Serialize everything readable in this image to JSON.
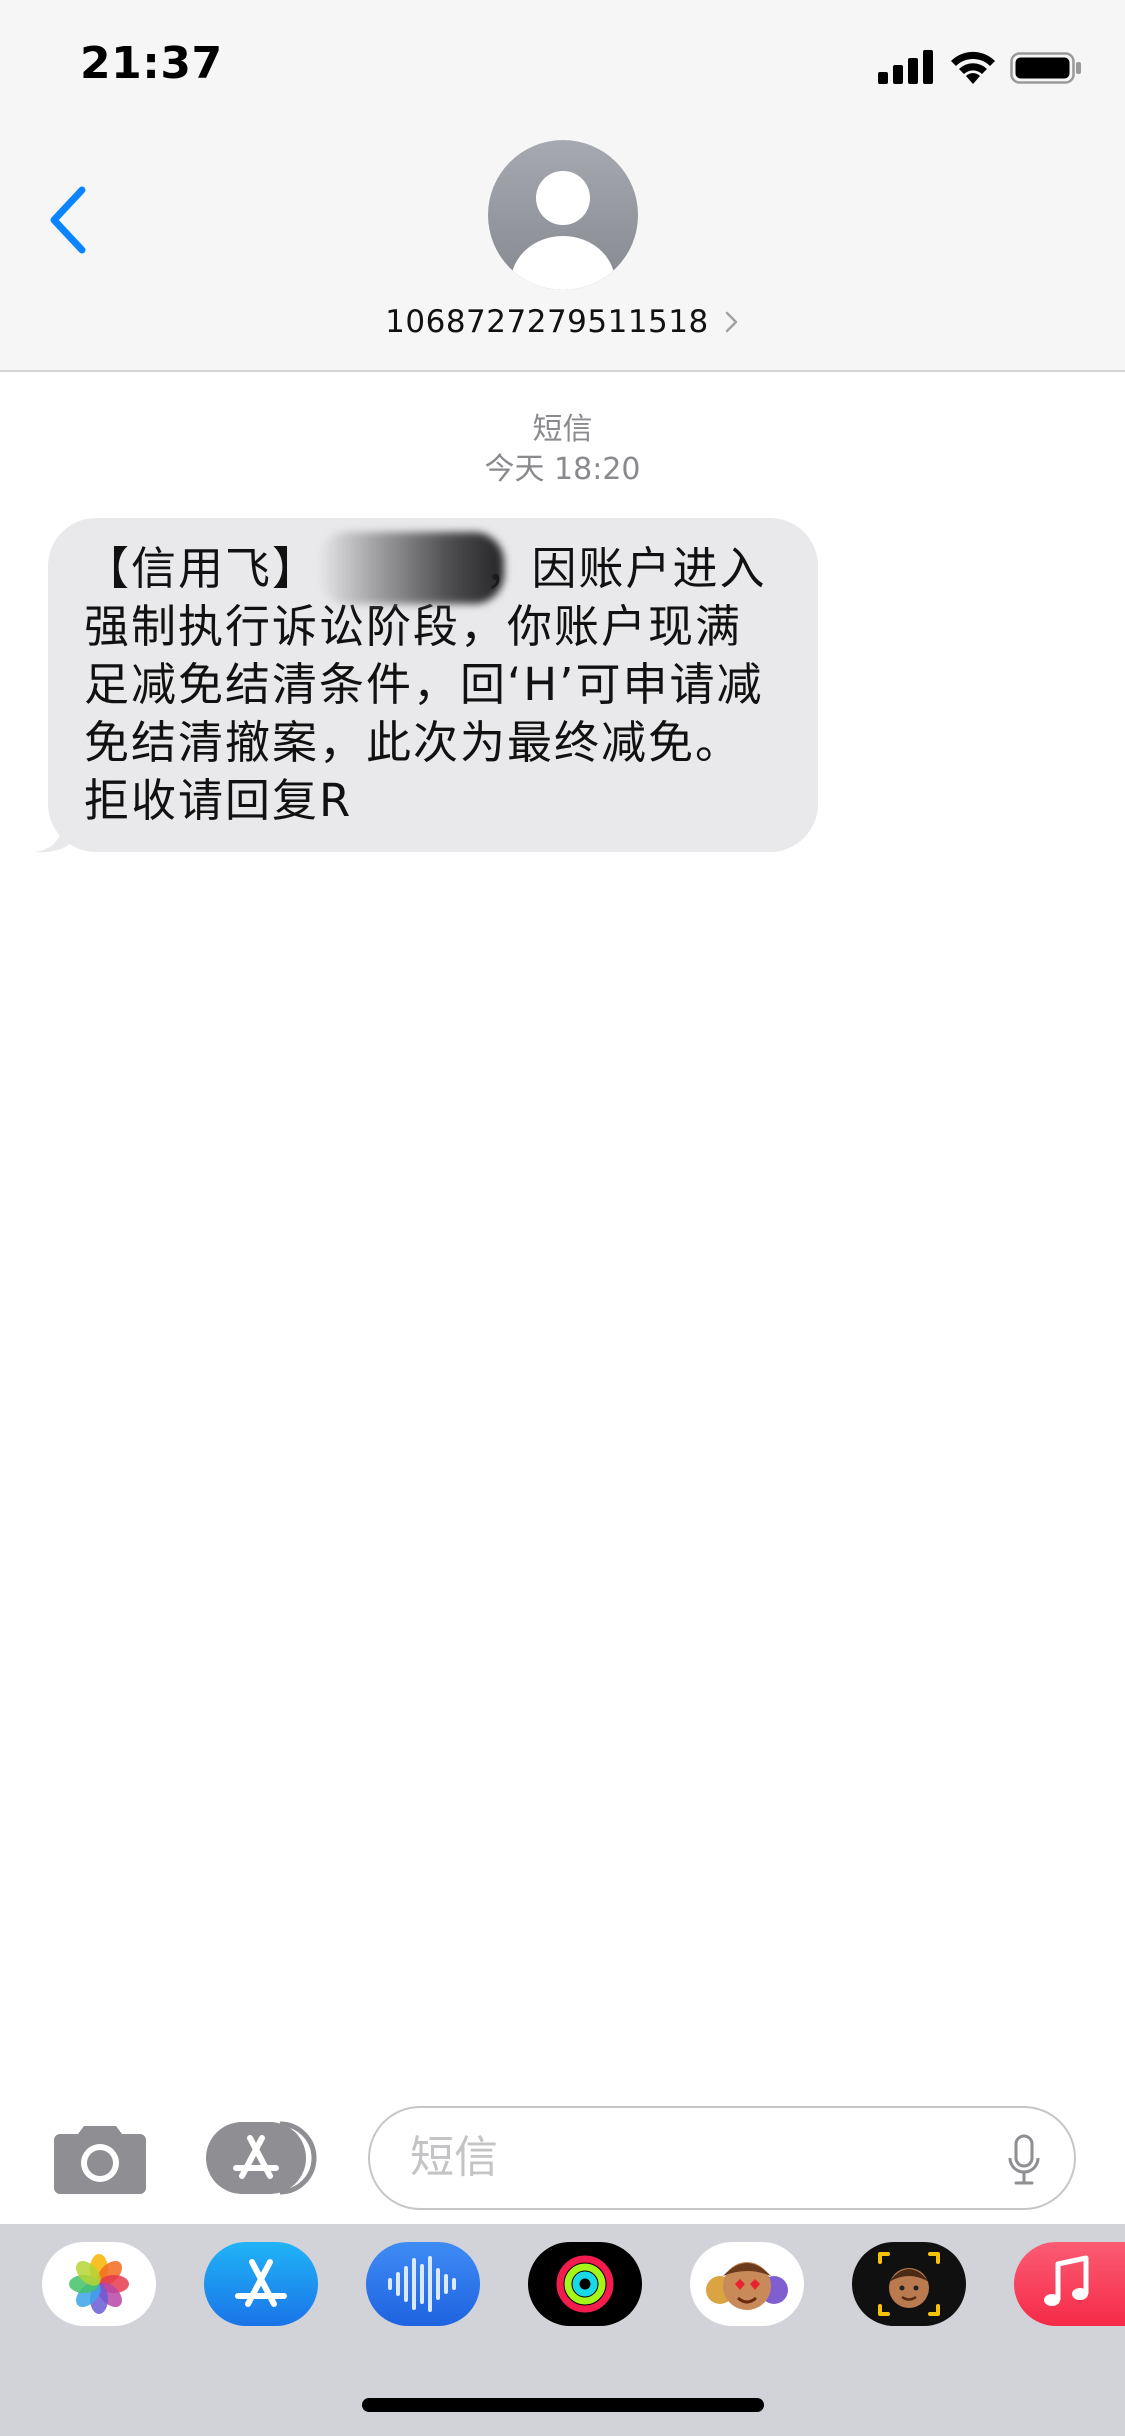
{
  "status_bar": {
    "time": "21:37"
  },
  "header": {
    "contact_number": "1068727279511518"
  },
  "conversation": {
    "service_label": "短信",
    "timestamp": "今天 18:20",
    "message_text": "【信用飞】　　　　，因账户进入强制执行诉讼阶段，你账户现满足减免结清条件，回‘H’可申请减免结清撤案，此次为最终减免。拒收请回复R"
  },
  "input_bar": {
    "placeholder": "短信"
  },
  "app_drawer": {
    "apps": [
      "photos-icon",
      "app-store-icon",
      "audio-message-icon",
      "activity-icon",
      "animoji-icon",
      "memoji-icon",
      "music-icon"
    ]
  },
  "colors": {
    "accent": "#0a84ff",
    "bubble_gray": "#e9e9eb",
    "header_bg": "#f6f6f6",
    "drawer_bg": "#d1d3d9"
  }
}
